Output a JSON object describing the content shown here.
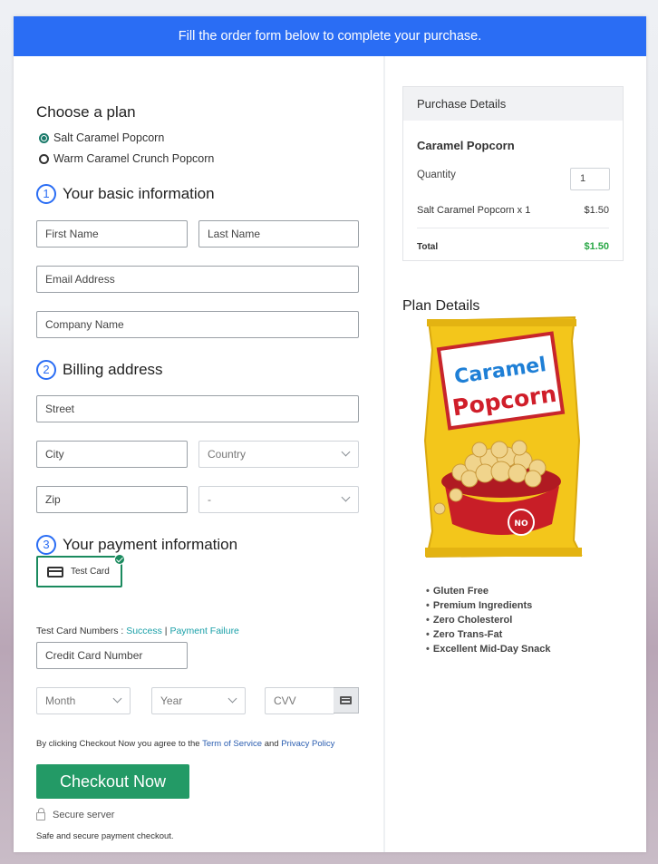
{
  "banner": {
    "text": "Fill the order form below to complete your purchase."
  },
  "plan": {
    "heading": "Choose a plan",
    "options": [
      {
        "label": "Salt Caramel Popcorn",
        "selected": true
      },
      {
        "label": "Warm Caramel Crunch Popcorn",
        "selected": false
      }
    ]
  },
  "basic": {
    "number": "1",
    "heading": "Your basic information",
    "first_name": "First Name",
    "last_name": "Last Name",
    "email": "Email Address",
    "company": "Company Name"
  },
  "billing": {
    "number": "2",
    "heading": "Billing address",
    "street": "Street",
    "city": "City",
    "country": "Country",
    "zip": "Zip",
    "state": "-"
  },
  "payment": {
    "number": "3",
    "heading": "Your payment information",
    "card_option": "Test Card",
    "test_numbers_label": "Test Card Numbers : ",
    "success_link": "Success",
    "separator": " | ",
    "failure_link": "Payment Failure",
    "card_number": "Credit Card Number",
    "month": "Month",
    "year": "Year",
    "cvv": "CVV"
  },
  "terms": {
    "prefix": "By clicking Checkout Now you agree to the ",
    "tos": "Term of Service",
    "and": " and ",
    "privacy": "Privacy Policy"
  },
  "checkout": {
    "button": "Checkout Now",
    "secure": "Secure server",
    "safe": "Safe and secure payment checkout."
  },
  "purchase": {
    "heading": "Purchase Details",
    "product": "Caramel Popcorn",
    "quantity_label": "Quantity",
    "quantity": "1",
    "line_item": "Salt Caramel Popcorn x 1",
    "line_price": "$1.50",
    "total_label": "Total",
    "total": "$1.50"
  },
  "plan_details": {
    "heading": "Plan Details",
    "product_text": {
      "brand": "Caramel",
      "name": "Popcorn",
      "badge": "NO"
    },
    "features": [
      "Gluten Free",
      "Premium Ingredients",
      "Zero Cholesterol",
      "Zero Trans-Fat",
      "Excellent Mid-Day Snack"
    ]
  },
  "colors": {
    "accent": "#2a6df4",
    "success": "#239a66",
    "total": "#28a745"
  }
}
